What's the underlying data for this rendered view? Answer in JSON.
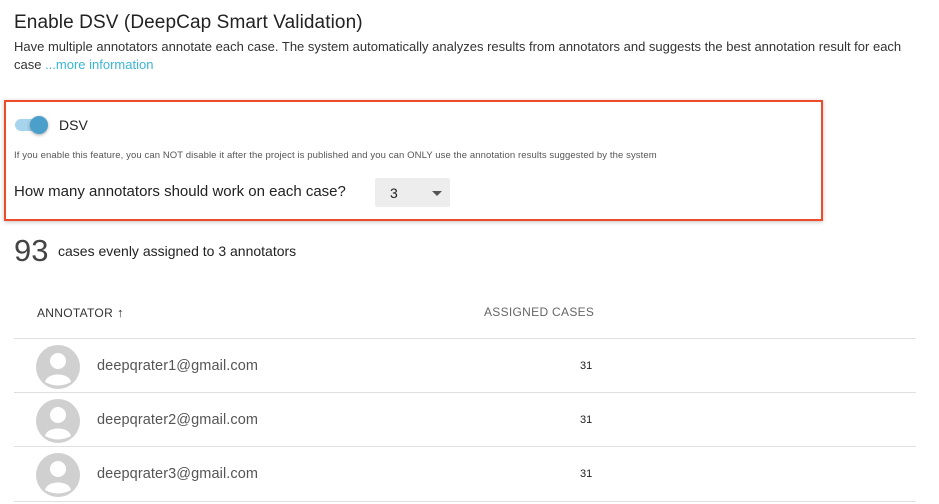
{
  "header": {
    "title": "Enable DSV (DeepCap Smart Validation)",
    "description": "Have multiple annotators annotate each case. The system automatically analyzes results from annotators and suggests the best annotation result for each case ",
    "more_link": "...more information"
  },
  "dsv": {
    "toggle_on": true,
    "label": "DSV",
    "warning": "If you enable this feature, you can NOT disable it after the project is published and you can ONLY use the annotation results suggested by the system",
    "question": "How many annotators should work on each case?",
    "annotators_per_case": "3"
  },
  "summary": {
    "count": "93",
    "text": "cases evenly assigned to 3 annotators"
  },
  "table": {
    "col_annotator": "ANNOTATOR",
    "col_assigned": "ASSIGNED CASES",
    "sort_icon": "arrow-up-icon",
    "rows": [
      {
        "email": "deepqrater1@gmail.com",
        "cases": "31"
      },
      {
        "email": "deepqrater2@gmail.com",
        "cases": "31"
      },
      {
        "email": "deepqrater3@gmail.com",
        "cases": "31"
      }
    ]
  },
  "colors": {
    "accent": "#4a9fcb",
    "link": "#3bb5d6",
    "highlight_border": "#ee4b2b"
  }
}
